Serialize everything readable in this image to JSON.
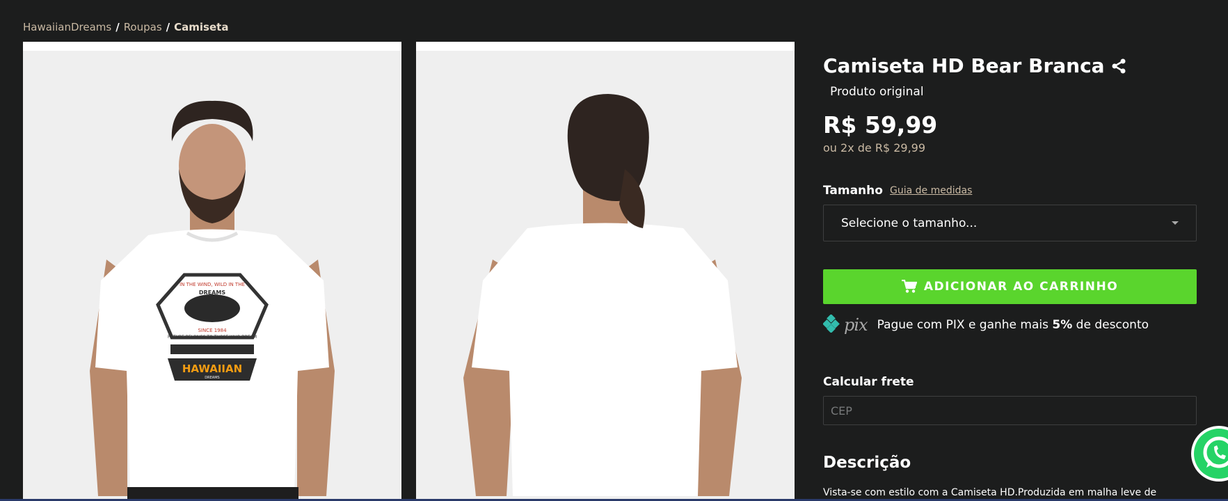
{
  "breadcrumb": {
    "items": [
      "HawaiianDreams",
      "Roupas"
    ],
    "separator": "/",
    "current": "Camiseta"
  },
  "product": {
    "title": "Camiseta HD Bear Branca",
    "original": "Produto original",
    "price": "R$ 59,99",
    "installments": "ou 2x de R$ 29,99"
  },
  "size": {
    "label": "Tamanho",
    "guide": "Guia de medidas",
    "select_value": "Selecione o tamanho..."
  },
  "cart": {
    "button_label": "ADICIONAR AO CARRINHO"
  },
  "pix": {
    "logo_text": "pix",
    "message_prefix": "Pague com PIX e ganhe mais ",
    "discount": "5%",
    "message_suffix": " de desconto"
  },
  "freight": {
    "label": "Calcular frete",
    "placeholder": "CEP"
  },
  "description": {
    "title": "Descrição",
    "text": "Vista-se com estilo com a Camiseta HD.Produzida em malha leve de"
  },
  "shirt_print": {
    "line1": "IN THE WIND, WILD IN THE",
    "brand_small": "DREAMS",
    "since": "SINCE 1984",
    "slogan": "FUTURE BELONGS TO THOSE WHO DREAM",
    "brand": "HAWAIIAN",
    "brand_sub": "DREAMS"
  },
  "colors": {
    "background": "#1c1d1d",
    "accent_green": "#5ad52d",
    "muted_tan": "#c9b9a3",
    "pix_teal": "#32bcad",
    "whatsapp": "#25d366"
  },
  "icons": {
    "share": "share-icon",
    "cart": "cart-icon",
    "caret": "chevron-down-icon",
    "pix": "pix-icon",
    "whatsapp": "whatsapp-icon"
  }
}
